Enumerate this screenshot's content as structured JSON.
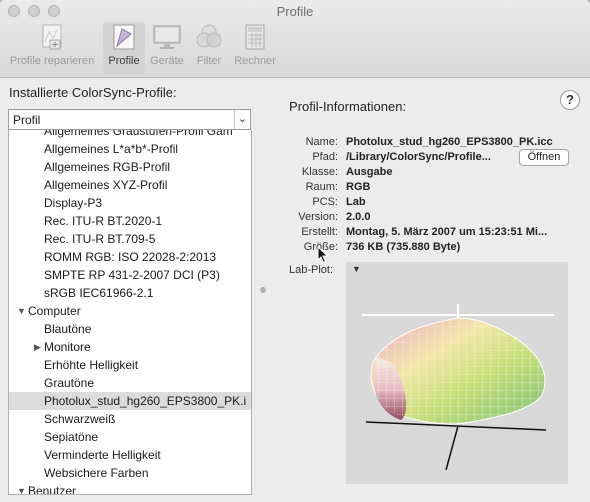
{
  "window": {
    "title": "Profile"
  },
  "toolbar": {
    "items": [
      {
        "label": "Profile reparieren",
        "icon": "repair-profile-icon",
        "active": false
      },
      {
        "label": "Profile",
        "icon": "profiles-icon",
        "active": true
      },
      {
        "label": "Geräte",
        "icon": "devices-icon",
        "active": false
      },
      {
        "label": "Filter",
        "icon": "filter-icon",
        "active": false
      },
      {
        "label": "Rechner",
        "icon": "calculator-icon",
        "active": false
      }
    ]
  },
  "left": {
    "title": "Installierte ColorSync-Profile:",
    "dropdown_value": "Profil",
    "rows": [
      {
        "label": "Allgemeines Graustufen-Profil Gam",
        "indent": 2,
        "selected": false
      },
      {
        "label": "Allgemeines L*a*b*-Profil",
        "indent": 2,
        "selected": false
      },
      {
        "label": "Allgemeines RGB-Profil",
        "indent": 2,
        "selected": false
      },
      {
        "label": "Allgemeines XYZ-Profil",
        "indent": 2,
        "selected": false
      },
      {
        "label": "Display-P3",
        "indent": 2,
        "selected": false
      },
      {
        "label": "Rec. ITU-R BT.2020-1",
        "indent": 2,
        "selected": false
      },
      {
        "label": "Rec. ITU-R BT.709-5",
        "indent": 2,
        "selected": false
      },
      {
        "label": "ROMM RGB: ISO 22028-2:2013",
        "indent": 2,
        "selected": false
      },
      {
        "label": "SMPTE RP 431-2-2007 DCI (P3)",
        "indent": 2,
        "selected": false
      },
      {
        "label": "sRGB IEC61966-2.1",
        "indent": 2,
        "selected": false
      },
      {
        "label": "Computer",
        "indent": 1,
        "disclosure": "open",
        "selected": false
      },
      {
        "label": "Blautöne",
        "indent": 2,
        "selected": false
      },
      {
        "label": "Monitore",
        "indent": 2,
        "disclosure": "closed",
        "selected": false
      },
      {
        "label": "Erhöhte Helligkeit",
        "indent": 2,
        "selected": false
      },
      {
        "label": "Grautöne",
        "indent": 2,
        "selected": false
      },
      {
        "label": "Photolux_stud_hg260_EPS3800_PK.i",
        "indent": 2,
        "selected": true
      },
      {
        "label": "Schwarzweiß",
        "indent": 2,
        "selected": false
      },
      {
        "label": "Sepiatöne",
        "indent": 2,
        "selected": false
      },
      {
        "label": "Verminderte Helligkeit",
        "indent": 2,
        "selected": false
      },
      {
        "label": "Websichere Farben",
        "indent": 2,
        "selected": false
      },
      {
        "label": "Benutzer",
        "indent": 1,
        "disclosure": "open",
        "selected": false
      }
    ]
  },
  "right": {
    "title": "Profil-Informationen:",
    "help_label": "?",
    "fields": [
      {
        "label": "Name:",
        "value": "Photolux_stud_hg260_EPS3800_PK.icc"
      },
      {
        "label": "Pfad:",
        "value": "/Library/ColorSync/Profile..."
      },
      {
        "label": "Klasse:",
        "value": "Ausgabe"
      },
      {
        "label": "Raum:",
        "value": "RGB"
      },
      {
        "label": "PCS:",
        "value": "Lab"
      },
      {
        "label": "Version:",
        "value": "2.0.0"
      },
      {
        "label": "Erstellt:",
        "value": "Montag, 5. März 2007 um 15:23:51 Mi..."
      },
      {
        "label": "Größe:",
        "value": "736 KB (735.880 Byte)"
      }
    ],
    "open_button": "Öffnen",
    "lab_plot_label": "Lab-Plot:"
  },
  "colors": {
    "selection": "#dcdcdc",
    "plot_background": "#d9d9d9"
  }
}
